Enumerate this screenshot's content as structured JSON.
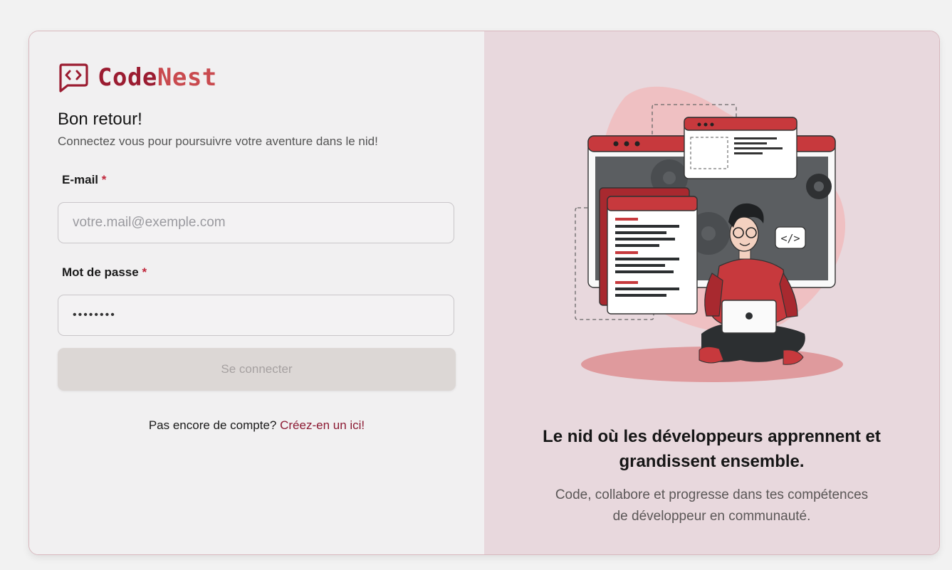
{
  "brand": {
    "name_part1": "Code",
    "name_part2": "Nest",
    "icon": "code-chat-icon"
  },
  "login": {
    "title": "Bon retour!",
    "subtitle": "Connectez vous pour poursuivre votre aventure dans le nid!",
    "email_label": "E-mail",
    "email_placeholder": "votre.mail@exemple.com",
    "password_label": "Mot de passe",
    "password_value": "••••••••",
    "required_mark": "*",
    "submit_label": "Se connecter",
    "signup_prompt": "Pas encore de compte?",
    "signup_link": "Créez-en un ici!"
  },
  "promo": {
    "tagline": "Le nid où les développeurs apprennent et grandissent ensemble.",
    "desc_line1": "Code, collabore et progresse dans tes compétences",
    "desc_line2": "de développeur en communauté."
  },
  "colors": {
    "brand_dark": "#9b1c31",
    "brand_light": "#c94a4f",
    "panel_bg": "#e8d8dd",
    "button_disabled": "#dcd7d5",
    "link": "#8c1a33"
  }
}
